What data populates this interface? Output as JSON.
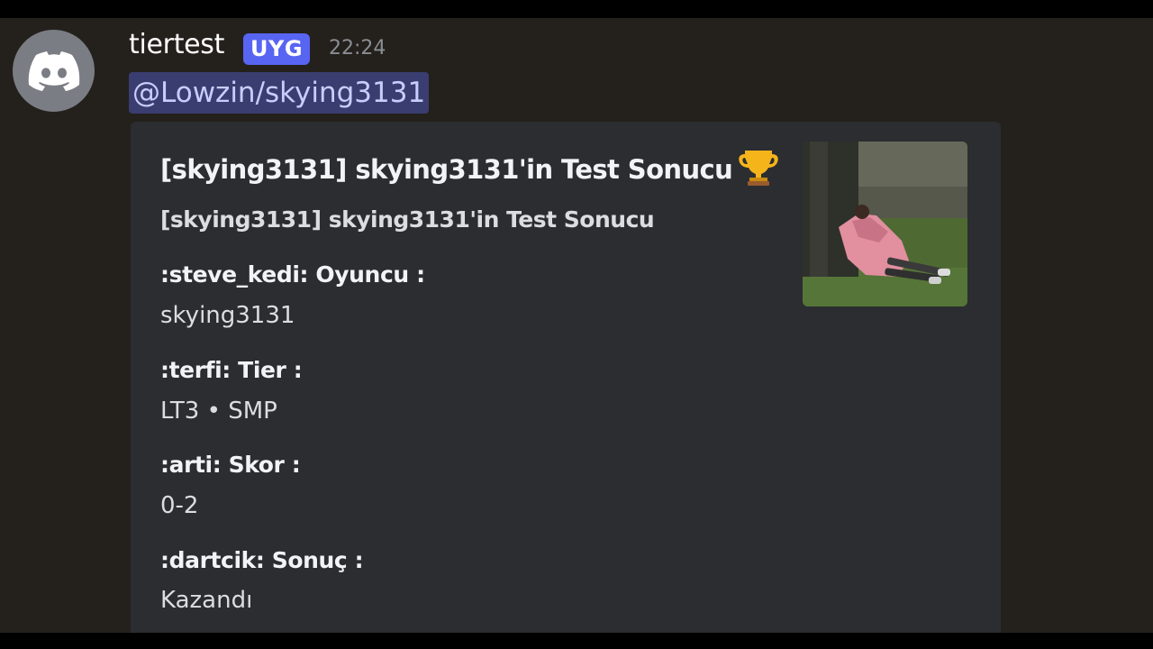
{
  "message": {
    "author": "tiertest",
    "app_tag": "UYG",
    "timestamp": "22:24",
    "mention": "@Lowzin/skying3131",
    "avatar_icon": "discord-logo-icon"
  },
  "embed": {
    "title": "[skying3131] skying3131'in Test Sonucu",
    "title_emoji": "trophy-icon",
    "description": "[skying3131] skying3131'in Test Sonucu",
    "fields": [
      {
        "name": ":steve_kedi: Oyuncu :",
        "value": "skying3131"
      },
      {
        "name": ":terfi: Tier :",
        "value": "LT3 • SMP"
      },
      {
        "name": ":arti: Skor :",
        "value": "0-2"
      },
      {
        "name": ":dartcik: Sonuç :",
        "value": "Kazandı"
      }
    ],
    "thumbnail": "person-lying-under-tree-photo"
  },
  "colors": {
    "background": "#24211c",
    "embed_background": "#2b2d31",
    "app_tag": "#5865f2",
    "mention_background": "#3a3d70",
    "mention_text": "#c9cdfb"
  }
}
